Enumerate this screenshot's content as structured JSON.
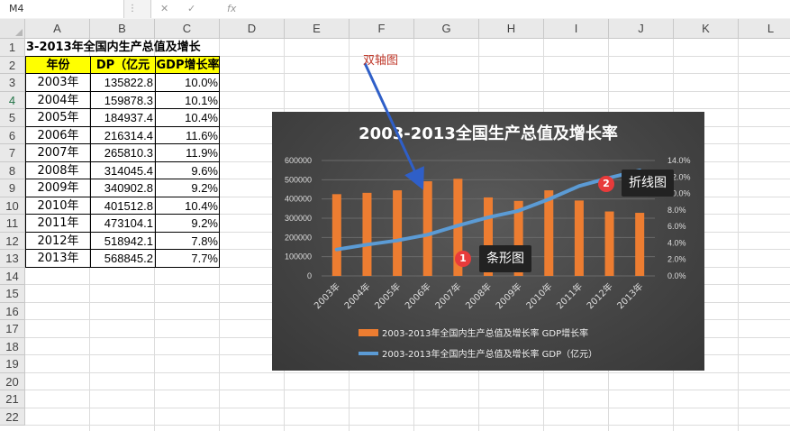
{
  "namebox": "M4",
  "formula_fx": "fx",
  "columns": [
    "A",
    "B",
    "C",
    "D",
    "E",
    "F",
    "G",
    "H",
    "I",
    "J",
    "K",
    "L"
  ],
  "rows": [
    "1",
    "2",
    "3",
    "4",
    "5",
    "6",
    "7",
    "8",
    "9",
    "10",
    "11",
    "12",
    "13",
    "14",
    "15",
    "16",
    "17",
    "18",
    "19",
    "20",
    "21",
    "22"
  ],
  "sheet": {
    "title": "3-2013年全国内生产总值及增长",
    "headers": [
      "年份",
      "DP（亿元",
      "GDP增长率"
    ],
    "data": [
      [
        "2003年",
        "135822.8",
        "10.0%"
      ],
      [
        "2004年",
        "159878.3",
        "10.1%"
      ],
      [
        "2005年",
        "184937.4",
        "10.4%"
      ],
      [
        "2006年",
        "216314.4",
        "11.6%"
      ],
      [
        "2007年",
        "265810.3",
        "11.9%"
      ],
      [
        "2008年",
        "314045.4",
        "9.6%"
      ],
      [
        "2009年",
        "340902.8",
        "9.2%"
      ],
      [
        "2010年",
        "401512.8",
        "10.4%"
      ],
      [
        "2011年",
        "473104.1",
        "9.2%"
      ],
      [
        "2012年",
        "518942.1",
        "7.8%"
      ],
      [
        "2013年",
        "568845.2",
        "7.7%"
      ]
    ]
  },
  "annotations": {
    "dual_axis": "双轴图",
    "bar_callout": "条形图",
    "bar_badge": "1",
    "line_callout": "折线图",
    "line_badge": "2"
  },
  "chart_data": {
    "type": "bar",
    "title": "2003-2013全国生产总值及增长率",
    "categories": [
      "2003年",
      "2004年",
      "2005年",
      "2006年",
      "2007年",
      "2008年",
      "2009年",
      "2010年",
      "2011年",
      "2012年",
      "2013年"
    ],
    "series": [
      {
        "name": "2003-2013年全国内生产总值及增长率 GDP增长率",
        "type": "bar",
        "axis": "left",
        "color": "#ed7d31",
        "values": [
          425000,
          432000,
          445000,
          492000,
          505000,
          408000,
          390000,
          445000,
          392000,
          335000,
          328000
        ]
      },
      {
        "name": "2003-2013年全国内生产总值及增长率 GDP（亿元）",
        "type": "line",
        "axis": "right",
        "color": "#5b9bd5",
        "values": [
          3.2,
          3.8,
          4.3,
          5.0,
          6.1,
          7.1,
          7.9,
          9.3,
          10.9,
          11.9,
          12.8
        ]
      }
    ],
    "ylim_left": [
      0,
      600000
    ],
    "yticks_left": [
      "0",
      "100000",
      "200000",
      "300000",
      "400000",
      "500000",
      "600000"
    ],
    "ylim_right": [
      0,
      14
    ],
    "yticks_right": [
      "0.0%",
      "2.0%",
      "4.0%",
      "6.0%",
      "8.0%",
      "10.0%",
      "12.0%",
      "14.0%"
    ],
    "grid": true,
    "legend_position": "bottom"
  }
}
